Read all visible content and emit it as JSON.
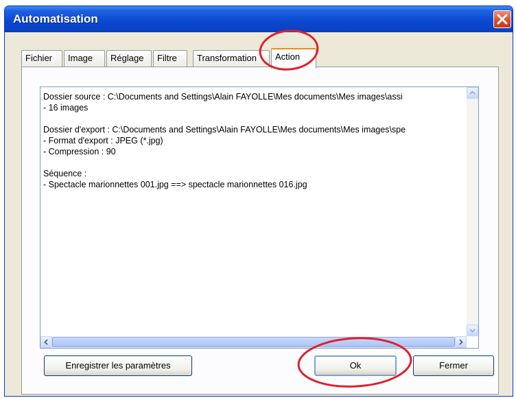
{
  "window": {
    "title": "Automatisation",
    "close_icon": "close-icon"
  },
  "tabs": [
    {
      "label": "Fichier",
      "active": false
    },
    {
      "label": "Image",
      "active": false
    },
    {
      "label": "Réglage",
      "active": false
    },
    {
      "label": "Filtre",
      "active": false
    },
    {
      "label": "Transformation",
      "active": false
    },
    {
      "label": "Action",
      "active": true
    }
  ],
  "summary": {
    "text": "Dossier source : C:\\Documents and Settings\\Alain FAYOLLE\\Mes documents\\Mes images\\assi\n- 16 images\n\nDossier d'export : C:\\Documents and Settings\\Alain FAYOLLE\\Mes documents\\Mes images\\spe\n- Format d'export : JPEG (*.jpg)\n- Compression : 90\n\nSéquence :\n- Spectacle marionnettes 001.jpg ==> spectacle marionnettes 016.jpg"
  },
  "buttons": {
    "save_label": "Enregistrer les paramètres",
    "ok_label": "Ok",
    "close_label": "Fermer"
  },
  "colors": {
    "annotation": "#e0202a"
  }
}
